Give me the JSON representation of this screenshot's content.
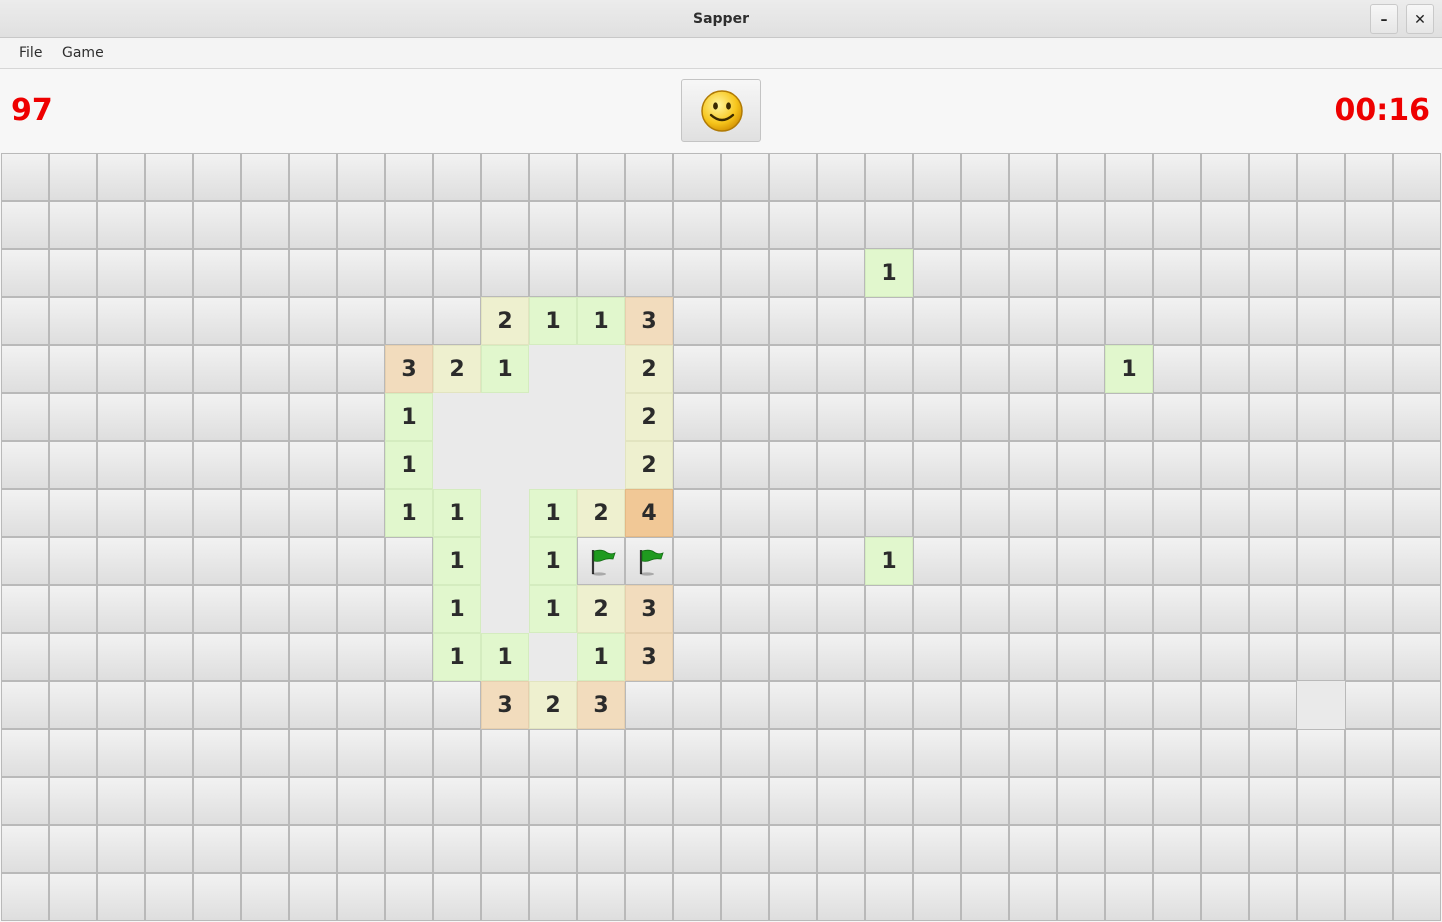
{
  "window": {
    "title": "Sapper",
    "minimize_label": "–",
    "close_label": "✕"
  },
  "menu": {
    "items": [
      "File",
      "Game"
    ]
  },
  "status": {
    "mines_left": "97",
    "timer": "00:16",
    "face_icon": "smiley-face-icon"
  },
  "colors": {
    "counter": "#ee0000",
    "number_1_bg": "#e1f7cd",
    "number_2_bg": "#eef0cf",
    "number_3_bg": "#f2dcbd",
    "number_4_bg": "#f1c896",
    "flag": "#1f9a1f"
  },
  "board": {
    "columns": 30,
    "rows": 16,
    "legend": "# = hidden, . = opened empty, F = flagged, digits = adjacent mine count",
    "grid": [
      "##############################",
      "##############################",
      "##################1###########",
      "##########2113################",
      "########321..2#########1######",
      "########1....2################",
      "########1....2################",
      "########11.124################",
      "#########1.1FF####1###########",
      "#########1.123################",
      "#########11.13################",
      "##########323##############.##",
      "##############################",
      "##############################",
      "##############################",
      "##############################"
    ]
  }
}
